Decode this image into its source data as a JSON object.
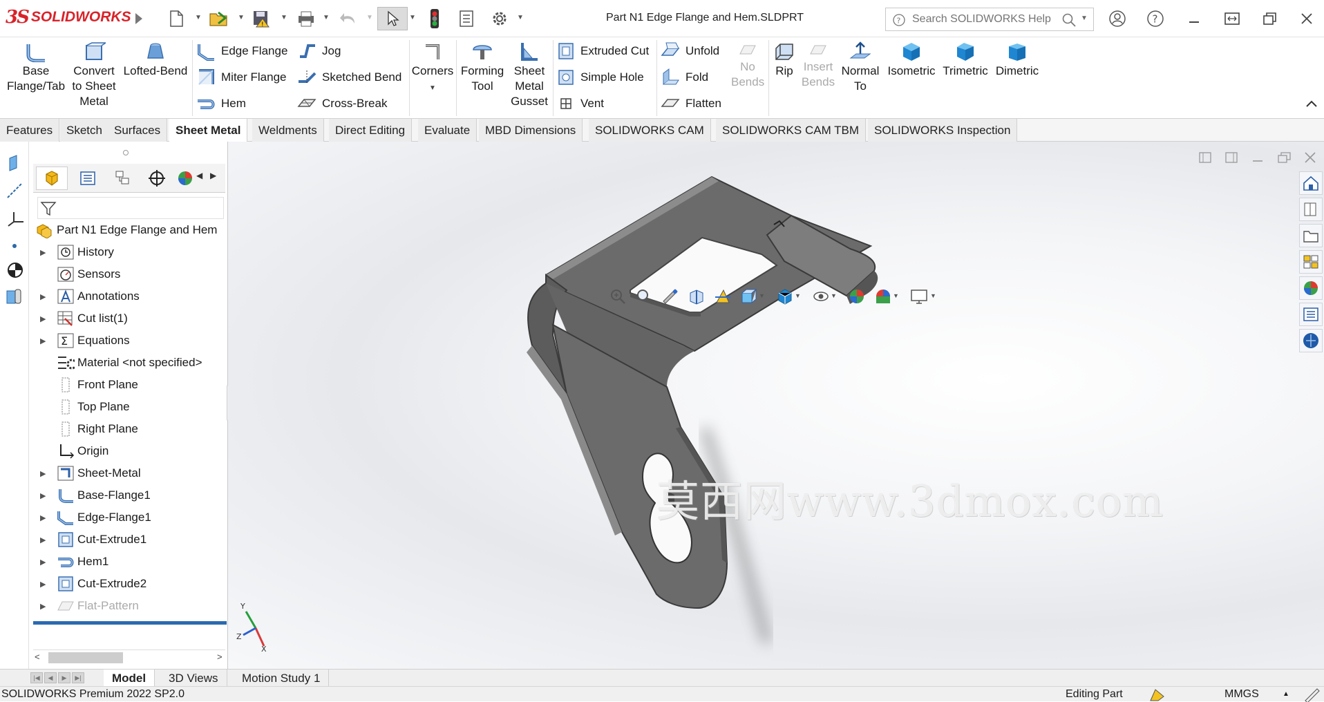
{
  "app": {
    "logo_text": "SOLIDWORKS",
    "doc_title": "Part N1 Edge Flange and Hem.SLDPRT"
  },
  "search": {
    "placeholder": "Search SOLIDWORKS Help"
  },
  "ribbon": {
    "base_flange": [
      "Base",
      "Flange/Tab"
    ],
    "convert": [
      "Convert",
      "to Sheet",
      "Metal"
    ],
    "lofted_bend": "Lofted-Bend",
    "edge_flange": "Edge Flange",
    "miter_flange": "Miter Flange",
    "hem": "Hem",
    "jog": "Jog",
    "sketched_bend": "Sketched Bend",
    "cross_break": "Cross-Break",
    "corners": "Corners",
    "forming_tool": [
      "Forming",
      "Tool"
    ],
    "gusset": [
      "Sheet",
      "Metal",
      "Gusset"
    ],
    "extruded_cut": "Extruded Cut",
    "simple_hole": "Simple Hole",
    "vent": "Vent",
    "unfold": "Unfold",
    "fold": "Fold",
    "flatten": "Flatten",
    "no_bends": [
      "No",
      "Bends"
    ],
    "rip": "Rip",
    "insert_bends": [
      "Insert",
      "Bends"
    ],
    "normal_to": [
      "Normal",
      "To"
    ],
    "isometric": "Isometric",
    "trimetric": "Trimetric",
    "dimetric": "Dimetric"
  },
  "tabs": [
    "Features",
    "Sketch",
    "Surfaces",
    "Sheet Metal",
    "Weldments",
    "Direct Editing",
    "Evaluate",
    "MBD Dimensions",
    "SOLIDWORKS CAM",
    "SOLIDWORKS CAM TBM",
    "SOLIDWORKS Inspection"
  ],
  "active_tab": "Sheet Metal",
  "tree": {
    "root": "Part N1 Edge Flange and Hem",
    "items": [
      {
        "label": "History",
        "icon": "history-icon",
        "expandable": true
      },
      {
        "label": "Sensors",
        "icon": "sensor-icon",
        "expandable": false
      },
      {
        "label": "Annotations",
        "icon": "annotation-icon",
        "expandable": true
      },
      {
        "label": "Cut list(1)",
        "icon": "cut-list-icon",
        "expandable": true
      },
      {
        "label": "Equations",
        "icon": "equations-icon",
        "expandable": true
      },
      {
        "label": "Material <not specified>",
        "icon": "material-icon",
        "expandable": false
      },
      {
        "label": "Front Plane",
        "icon": "plane-icon",
        "expandable": false
      },
      {
        "label": "Top Plane",
        "icon": "plane-icon",
        "expandable": false
      },
      {
        "label": "Right Plane",
        "icon": "plane-icon",
        "expandable": false
      },
      {
        "label": "Origin",
        "icon": "origin-icon",
        "expandable": false
      },
      {
        "label": "Sheet-Metal",
        "icon": "sheet-metal-icon",
        "expandable": true
      },
      {
        "label": "Base-Flange1",
        "icon": "base-flange-icon",
        "expandable": true
      },
      {
        "label": "Edge-Flange1",
        "icon": "edge-flange-icon",
        "expandable": true
      },
      {
        "label": "Cut-Extrude1",
        "icon": "cut-extrude-icon",
        "expandable": true
      },
      {
        "label": "Hem1",
        "icon": "hem-icon",
        "expandable": true
      },
      {
        "label": "Cut-Extrude2",
        "icon": "cut-extrude-icon",
        "expandable": true
      },
      {
        "label": "Flat-Pattern",
        "icon": "flat-pattern-icon",
        "expandable": true,
        "suppressed": true
      }
    ]
  },
  "bottom_tabs": [
    "Model",
    "3D Views",
    "Motion Study 1"
  ],
  "active_bottom_tab": "Model",
  "watermark": "莫西网www.3dmox.com",
  "status": {
    "left": "SOLIDWORKS Premium 2022 SP2.0",
    "mode": "Editing Part",
    "units": "MMGS"
  },
  "colors": {
    "brand": "#d8232a",
    "part": "#6b6b6b",
    "tree_blue": "#2b5fa8"
  }
}
